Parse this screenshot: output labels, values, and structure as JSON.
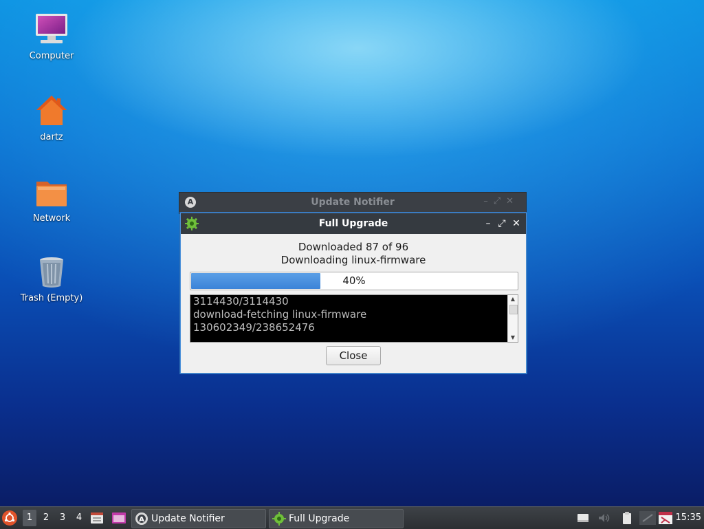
{
  "desktop": {
    "icons": [
      {
        "label": "Computer",
        "icon": "computer-icon"
      },
      {
        "label": "dartz",
        "icon": "home-folder-icon"
      },
      {
        "label": "Network",
        "icon": "network-folder-icon"
      },
      {
        "label": "Trash (Empty)",
        "icon": "trash-icon"
      }
    ]
  },
  "background_window": {
    "title": "Update Notifier",
    "icon": "update-notifier-icon"
  },
  "dialog": {
    "title": "Full Upgrade",
    "icon": "gear-icon",
    "status_line_1": "Downloaded 87 of 96",
    "status_line_2": "Downloading linux-firmware",
    "progress_percent": 40,
    "progress_label": "40%",
    "log_lines": [
      "3114430/3114430",
      "download-fetching linux-firmware",
      "130602349/238652476"
    ],
    "close_label": "Close",
    "minimize_glyph": "–",
    "maximize_glyph": "⤢",
    "close_glyph": "✕"
  },
  "taskbar": {
    "workspaces": [
      "1",
      "2",
      "3",
      "4"
    ],
    "active_workspace": "1",
    "tasks": [
      {
        "label": "Update Notifier",
        "icon": "update-notifier-icon"
      },
      {
        "label": "Full Upgrade",
        "icon": "gear-icon"
      }
    ],
    "clock": "15:35"
  },
  "colors": {
    "accent": "#3b83d8",
    "titlebar": "#353a40",
    "taskbar": "#2c2f33"
  }
}
